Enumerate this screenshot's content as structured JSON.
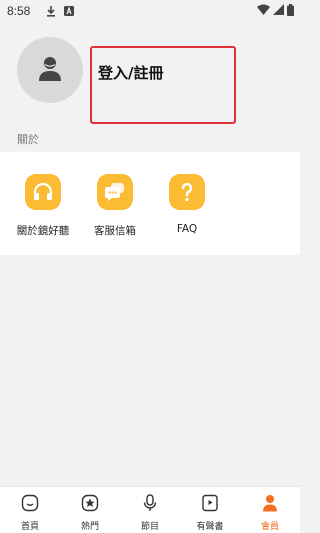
{
  "status_bar": {
    "time": "8:58",
    "icons": [
      "download-icon",
      "notification-a-icon",
      "wifi-icon",
      "signal-icon",
      "battery-icon"
    ]
  },
  "profile": {
    "avatar_icon": "user-avatar-icon",
    "login_label": "登入/註冊"
  },
  "about_section": {
    "label": "關於",
    "items": [
      {
        "label": "關於鏡好聽",
        "icon": "headphones-icon"
      },
      {
        "label": "客服信箱",
        "icon": "chat-bubble-icon"
      },
      {
        "label": "FAQ",
        "icon": "question-icon"
      }
    ]
  },
  "bottom_nav": {
    "items": [
      {
        "label": "首頁",
        "icon": "home-icon"
      },
      {
        "label": "熱門",
        "icon": "star-icon"
      },
      {
        "label": "節目",
        "icon": "microphone-icon"
      },
      {
        "label": "有聲書",
        "icon": "play-book-icon"
      },
      {
        "label": "會員",
        "icon": "member-icon",
        "active": true
      }
    ]
  },
  "colors": {
    "accent": "#f2701f",
    "icon_yellow": "#fbbb33",
    "highlight_border": "#e0303c",
    "background": "#f2f2f2"
  }
}
